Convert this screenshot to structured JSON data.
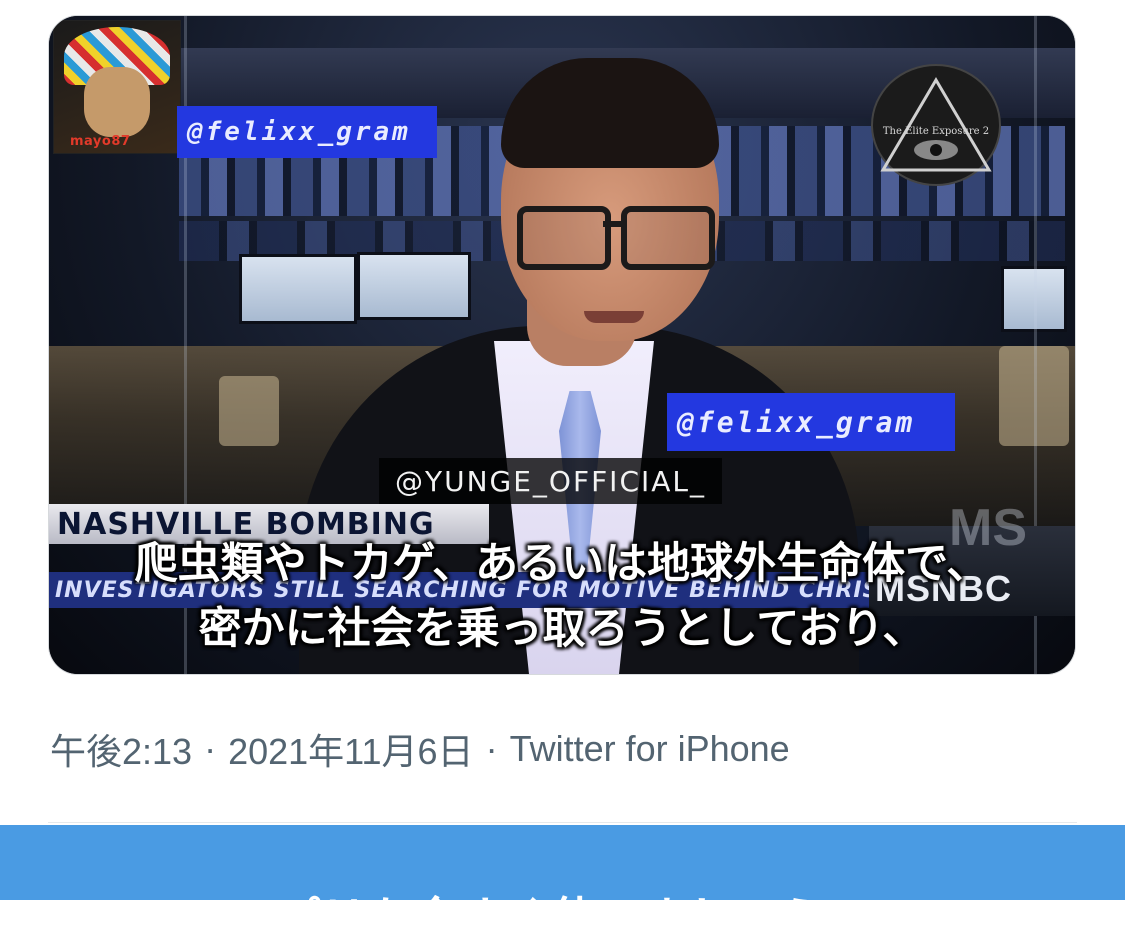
{
  "video": {
    "corner_logo_tag": "mayo87",
    "watermark_top": "@felixx_gram",
    "watermark_right": "@felixx_gram",
    "uploader_tag": "@YUNGE_OFFICIAL_",
    "channel_badge": "The Elite Exposure 2",
    "lower_third": "NASHVILLE BOMBING",
    "ticker": "INVESTIGATORS STILL SEARCHING FOR MOTIVE BEHIND CHRISTMAS DAY BLAST",
    "network_logo": "MSNBC",
    "network_logo_faded": "MS",
    "subtitle_line1": "爬虫類やトカゲ、あるいは地球外生命体で、",
    "subtitle_line2": "密かに社会を乗っ取ろうとしており、"
  },
  "meta": {
    "time": "午後2:13",
    "separator": "·",
    "date": "2021年11月6日",
    "source": "Twitter for iPhone"
  },
  "banner": {
    "text": "スペースアプリを今すぐ使いましょう"
  },
  "colors": {
    "meta_text": "#536471",
    "banner_bg": "#4a9be3",
    "watermark_bg": "#2338e0"
  }
}
